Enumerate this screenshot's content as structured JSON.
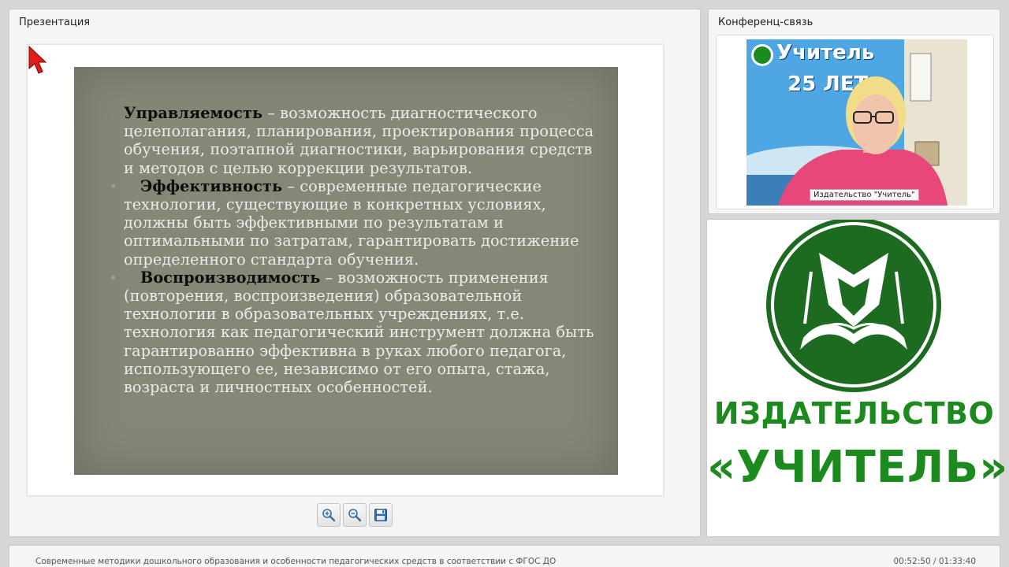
{
  "presentation": {
    "title": "Презентация",
    "slide": {
      "p1_term": "Управляемость",
      "p1_text": " – возможность диагностического целеполагания, планирования, проектирования процесса обучения, поэтапной диагностики, варьирования средств и методов с целью коррекции результатов.",
      "p2_term": "Эффективность",
      "p2_text": " – современные педагогические технологии, существующие в конкретных условиях, должны быть эффективными по результатам и оптимальными по затратам, гарантировать достижение определенного стандарта обучения.",
      "p3_term": "Воспроизводимость",
      "p3_text": " – возможность применения (повторения, воспроизведения) образовательной технологии в образовательных учреждениях, т.е. технология как педагогический инструмент должна быть гарантированно эффективна в руках любого педагога, использующего ее, независимо от его опыта, стажа, возраста и личностных особенностей."
    },
    "toolbar": {
      "zoom_in_icon": "zoom-in-icon",
      "zoom_out_icon": "zoom-out-icon",
      "save_icon": "save-icon"
    }
  },
  "conference": {
    "title": "Конференц-связь",
    "video_label": "Издательство \"Учитель\"",
    "banner_name": "Учитель",
    "banner_years": "25 ЛЕТ"
  },
  "logo": {
    "line1": "ИЗДАТЕЛЬСТВО",
    "line2": "«УЧИТЕЛЬ»",
    "color": "#1c6b20"
  },
  "footer": {
    "course_title": "Современные методики дошкольного образования и особенности педагогических средств в соответствии с ФГОС ДО",
    "time": "00:52:50 / 01:33:40"
  }
}
